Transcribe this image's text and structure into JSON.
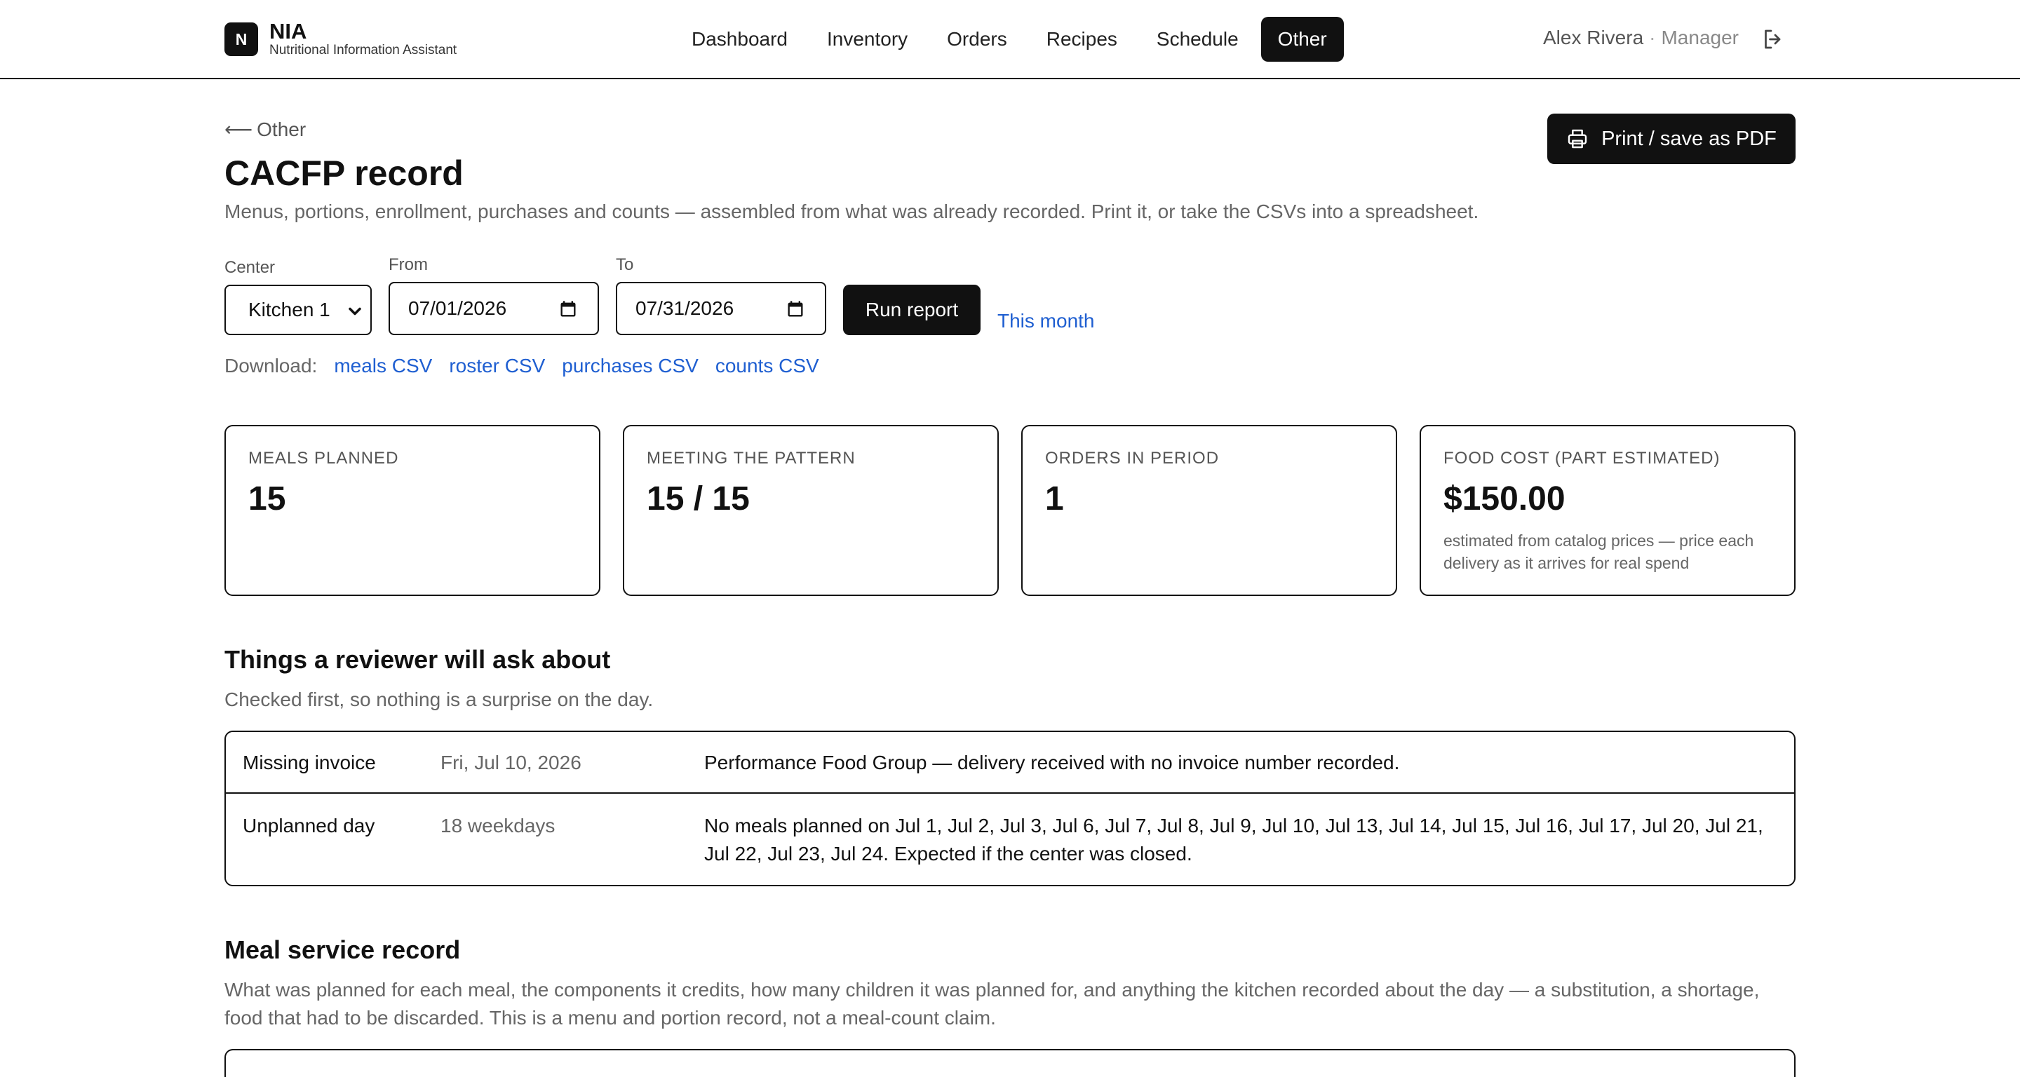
{
  "app": {
    "brand_letter": "N",
    "brand_name": "NIA",
    "brand_subtitle": "Nutritional Information Assistant"
  },
  "nav": {
    "items": [
      {
        "label": "Dashboard",
        "active": false
      },
      {
        "label": "Inventory",
        "active": false
      },
      {
        "label": "Orders",
        "active": false
      },
      {
        "label": "Recipes",
        "active": false
      },
      {
        "label": "Schedule",
        "active": false
      },
      {
        "label": "Other",
        "active": true
      }
    ]
  },
  "user": {
    "name": "Alex Rivera",
    "separator": "·",
    "role": "Manager",
    "logout_icon": "logout-icon"
  },
  "header": {
    "back_arrow": "⟵",
    "back_label": "Other",
    "title": "CACFP record",
    "subtitle": "Menus, portions, enrollment, purchases and counts — assembled from what was already recorded. Print it, or take the CSVs into a spreadsheet.",
    "print_label": "Print / save as PDF",
    "print_icon": "printer-icon"
  },
  "filters": {
    "center_label": "Center",
    "center_value": "Kitchen 1",
    "from_label": "From",
    "from_value": "07/01/2026",
    "to_label": "To",
    "to_value": "07/31/2026",
    "run_label": "Run report",
    "this_month_label": "This month"
  },
  "downloads": {
    "label": "Download:",
    "links": [
      "meals CSV",
      "roster CSV",
      "purchases CSV",
      "counts CSV"
    ]
  },
  "stats": [
    {
      "label": "MEALS PLANNED",
      "value": "15",
      "note": ""
    },
    {
      "label": "MEETING THE PATTERN",
      "value": "15 / 15",
      "note": ""
    },
    {
      "label": "ORDERS IN PERIOD",
      "value": "1",
      "note": ""
    },
    {
      "label": "FOOD COST (PART ESTIMATED)",
      "value": "$150.00",
      "note": "estimated from catalog prices — price each delivery as it arrives for real spend"
    }
  ],
  "review": {
    "title": "Things a reviewer will ask about",
    "desc": "Checked first, so nothing is a surprise on the day.",
    "rows": [
      {
        "type": "Missing invoice",
        "when": "Fri, Jul 10, 2026",
        "detail": "Performance Food Group — delivery received with no invoice number recorded."
      },
      {
        "type": "Unplanned day",
        "when": "18 weekdays",
        "detail": "No meals planned on Jul 1, Jul 2, Jul 3, Jul 6, Jul 7, Jul 8, Jul 9, Jul 10, Jul 13, Jul 14, Jul 15, Jul 16, Jul 17, Jul 20, Jul 21, Jul 22, Jul 23, Jul 24. Expected if the center was closed."
      }
    ]
  },
  "meal_service": {
    "title": "Meal service record",
    "desc": "What was planned for each meal, the components it credits, how many children it was planned for, and anything the kitchen recorded about the day — a substitution, a shortage, food that had to be discarded. This is a menu and portion record, not a meal-count claim."
  }
}
